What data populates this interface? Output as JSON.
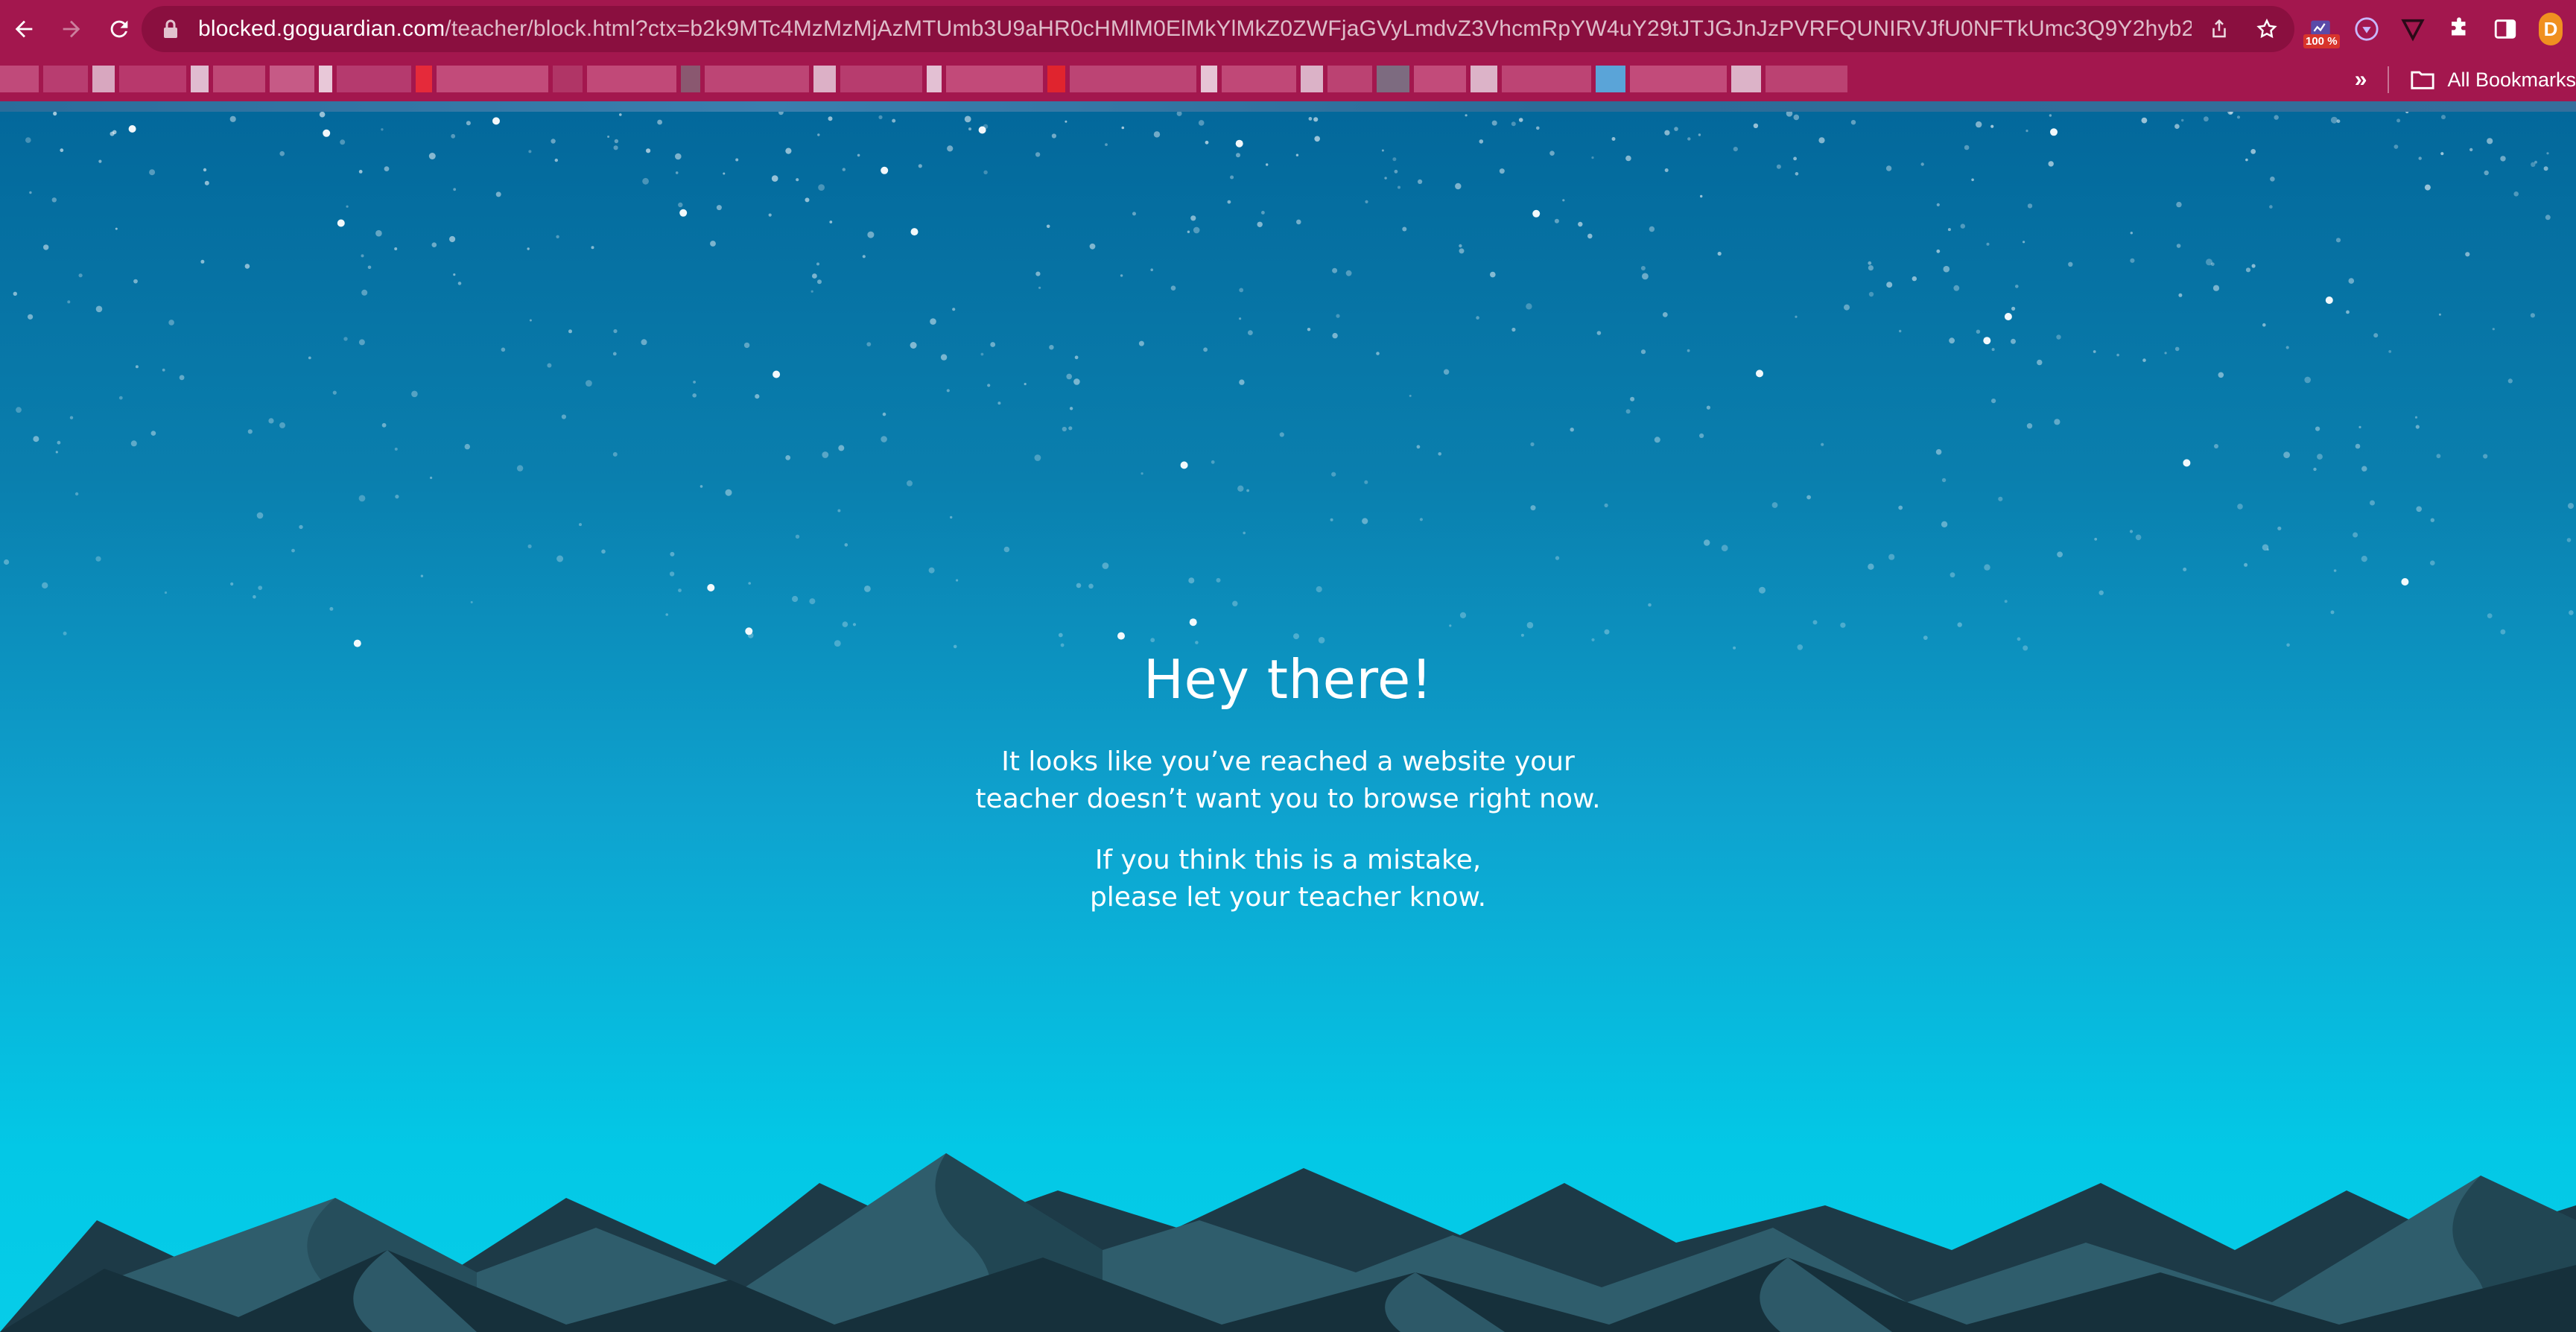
{
  "browser": {
    "url_host": "blocked.goguardian.com",
    "url_path": "/teacher/block.html?ctx=b2k9MTc4MzMzMjAzMTUmb3U9aHR0cHMlM0ElMkYlMkZ0ZWFjaGVyLmdvZ3VhcmRpYW4uY29tJTJGJnJzPVRFQUNIRVJfU0NFTkUmc3Q9Y2hyb21pd...",
    "extension_badge": "100 %",
    "profile_initial": "D",
    "bookmarks_overflow": "»",
    "all_bookmarks_label": "All Bookmarks"
  },
  "page": {
    "heading": "Hey there!",
    "paragraph1_line1": "It looks like you’ve reached a website your",
    "paragraph1_line2": "teacher doesn’t want you to browse right now.",
    "paragraph2_line1": "If you think this is a mistake,",
    "paragraph2_line2": "please let your teacher know."
  },
  "colors": {
    "chrome_accent": "#a3174e",
    "sky_top": "#03689b",
    "sky_bottom": "#06cde8"
  }
}
